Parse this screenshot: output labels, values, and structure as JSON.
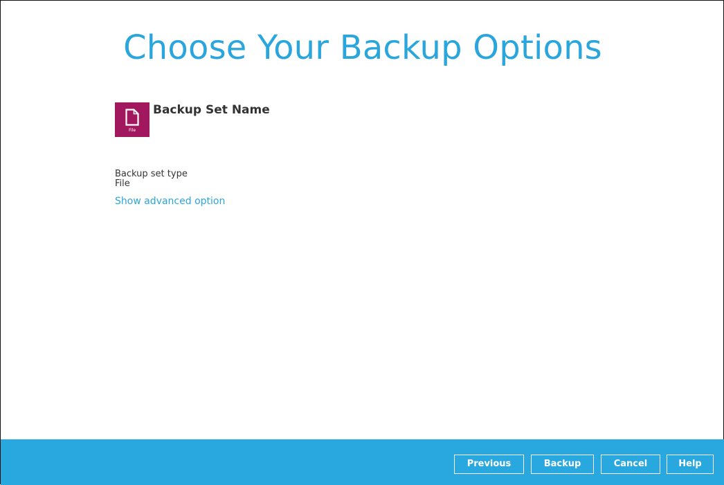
{
  "page": {
    "title": "Choose Your Backup Options"
  },
  "backup_set": {
    "name": "Backup Set Name",
    "icon": "file-icon",
    "icon_label": "File",
    "icon_color": "#a1185f",
    "type_label": "Backup set type",
    "type_value": "File"
  },
  "links": {
    "advanced": "Show advanced option"
  },
  "footer": {
    "background": "#29a8e0",
    "buttons": {
      "previous": "Previous",
      "backup": "Backup",
      "cancel": "Cancel",
      "help": "Help"
    }
  },
  "colors": {
    "accent": "#2aa6dd",
    "text": "#333333"
  }
}
